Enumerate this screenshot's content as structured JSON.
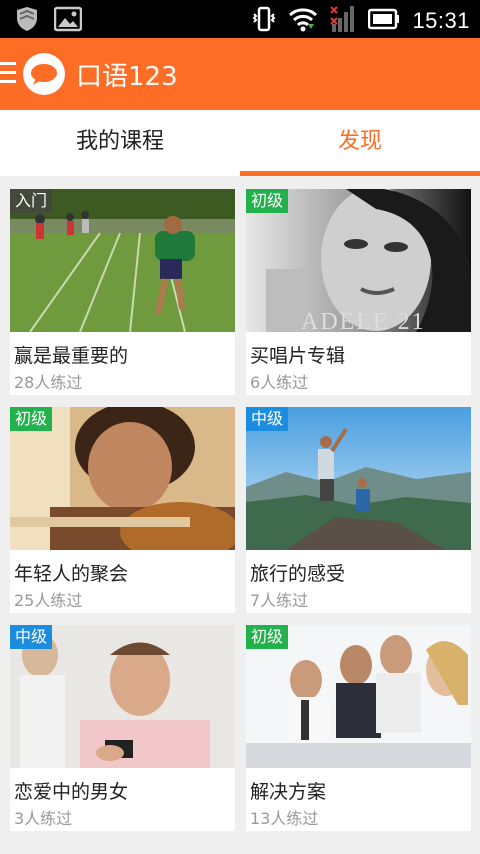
{
  "status": {
    "time": "15:31"
  },
  "app": {
    "title": "口语123"
  },
  "tabs": [
    {
      "label": "我的课程",
      "active": false
    },
    {
      "label": "发现",
      "active": true
    }
  ],
  "colors": {
    "accent": "#fe6d26",
    "badge_green": "#22b14c",
    "badge_blue": "#1b8de0"
  },
  "cards": [
    {
      "level": "入门",
      "title": "赢是最重要的",
      "count": "28人练过",
      "image": "runner-boy-photo"
    },
    {
      "level": "初级",
      "title": "买唱片专辑",
      "count": "6人练过",
      "image": "adele-album-photo"
    },
    {
      "level": "初级",
      "title": "年轻人的聚会",
      "count": "25人练过",
      "image": "boy-guitar-photo"
    },
    {
      "level": "中级",
      "title": "旅行的感受",
      "count": "7人练过",
      "image": "hikers-mountain-photo"
    },
    {
      "level": "中级",
      "title": "恋爱中的男女",
      "count": "3人练过",
      "image": "man-phone-photo"
    },
    {
      "level": "初级",
      "title": "解决方案",
      "count": "13人练过",
      "image": "business-meeting-photo"
    }
  ],
  "album_art_text": "ADELE 21"
}
